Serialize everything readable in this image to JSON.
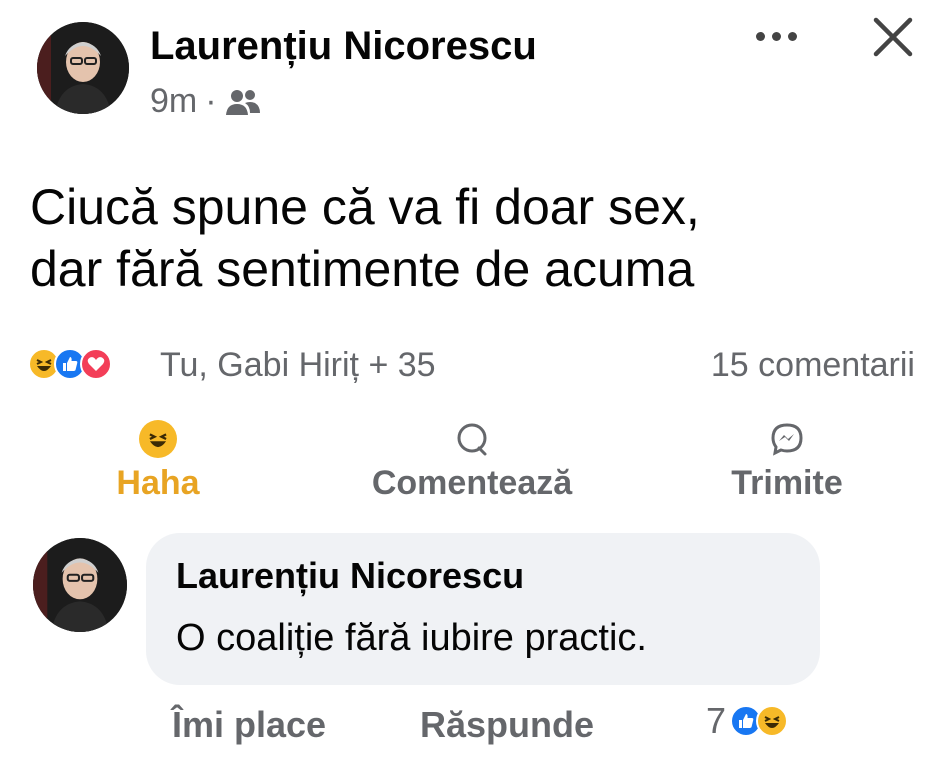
{
  "post": {
    "author": "Laurențiu Nicorescu",
    "time": "9m",
    "separator": "·",
    "audience_icon": "friends-icon",
    "text_line1": "Ciucă spune că va fi doar sex,",
    "text_line2": "dar fără sentimente de acuma"
  },
  "header_controls": {
    "more_icon": "more-icon",
    "close_icon": "close-icon"
  },
  "reactions": {
    "icons": [
      "haha-icon",
      "like-icon",
      "love-icon"
    ],
    "summary": "Tu, Gabi Hiriț + 35",
    "comments_count": "15 comentarii"
  },
  "actions": {
    "haha_label": "Haha",
    "comment_label": "Comentează",
    "send_label": "Trimite"
  },
  "comment": {
    "author": "Laurențiu Nicorescu",
    "text": "O coaliție fără iubire practic.",
    "like_label": "Îmi place",
    "reply_label": "Răspunde",
    "reaction_count": "7",
    "reaction_icons": [
      "like-icon",
      "haha-icon"
    ]
  },
  "colors": {
    "haha_active": "#e8a423",
    "like_blue": "#1877f2",
    "love_red": "#f33e58",
    "haha_yellow": "#f7b928",
    "meta_gray": "#65676b",
    "bubble_bg": "#f0f2f5"
  }
}
